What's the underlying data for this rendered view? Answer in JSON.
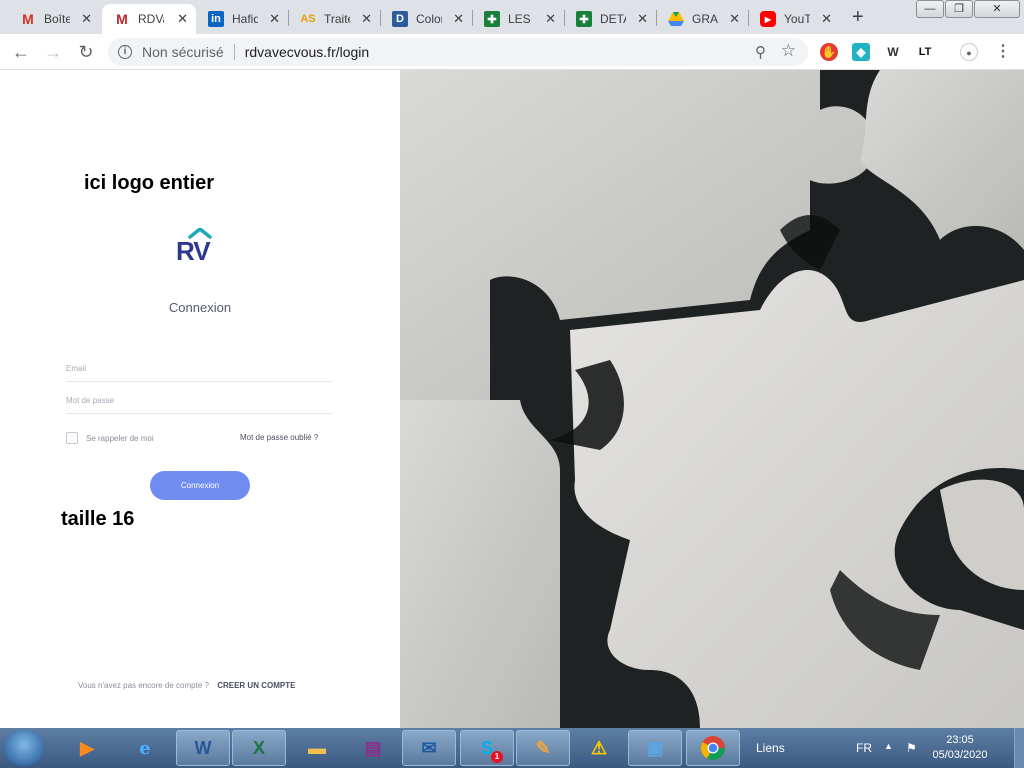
{
  "browser": {
    "tabs": [
      {
        "title": "Boîte de réception",
        "icon": "gmail-icon",
        "active": false
      },
      {
        "title": "RDVavecvous",
        "icon": "rdv-icon",
        "active": true
      },
      {
        "title": "Hafida",
        "icon": "linkedin-icon",
        "active": false
      },
      {
        "title": "Traitement",
        "icon": "as-icon",
        "active": false
      },
      {
        "title": "Coloriage",
        "icon": "d-icon",
        "active": false
      },
      {
        "title": "LES BASES",
        "icon": "sheets-icon",
        "active": false
      },
      {
        "title": "DETAIL",
        "icon": "sheets-icon",
        "active": false
      },
      {
        "title": "GRAPHIQUES",
        "icon": "drive-icon",
        "active": false
      },
      {
        "title": "YouTube",
        "icon": "youtube-icon",
        "active": false
      }
    ],
    "new_tab": "+",
    "security": "Non sécurisé",
    "url": "rdvavecvous.fr/login",
    "window_buttons": [
      "—",
      "❐",
      "✕"
    ]
  },
  "page": {
    "note_logo": "ici logo entier",
    "logo_text": "RV",
    "heading": "Connexion",
    "email_placeholder": "Email",
    "password_placeholder": "Mot de passe",
    "remember_label": "Se rappeler de moi",
    "forgot_label": "Mot de passe oublié ?",
    "submit_label": "Connexion",
    "note_size": "taille 16",
    "footer_text": "Vous n'avez pas encore de compte ?",
    "footer_link": "CREER UN COMPTE"
  },
  "taskbar": {
    "links_label": "Liens",
    "lang": "FR",
    "time": "23:05",
    "date": "05/03/2020",
    "skype_badge": "1"
  },
  "colors": {
    "accent": "#6f8cf0",
    "logo_blue": "#2b3990",
    "logo_teal": "#1ba8b8"
  }
}
